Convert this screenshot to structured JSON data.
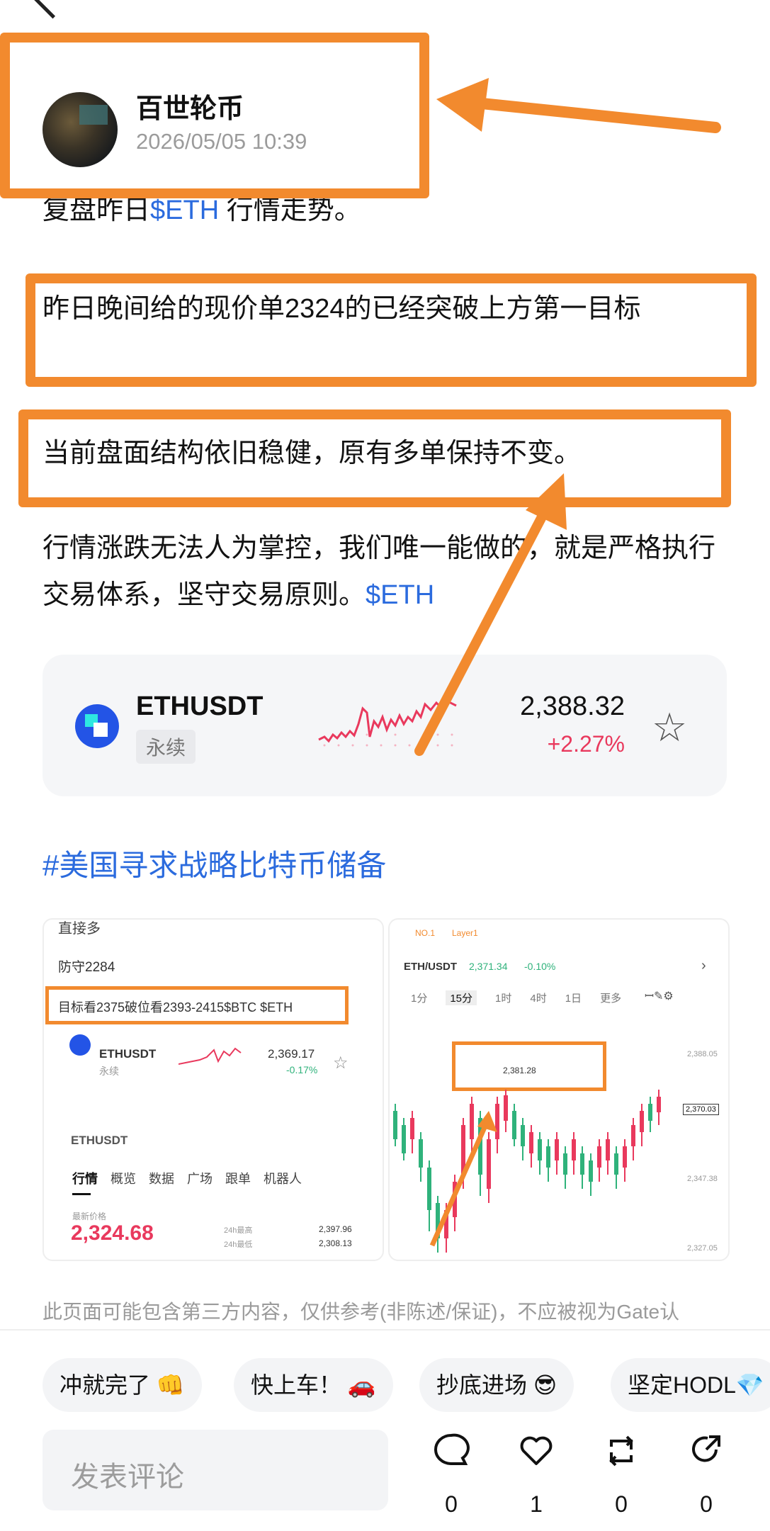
{
  "post": {
    "author": "百世轮币",
    "timestamp": "2026/05/05 10:39",
    "line1_text": "复盘昨日",
    "line1_tag": "$ETH",
    "line1_rest": " 行情走势。",
    "line2": "昨日晚间给的现价单2324的已经突破上方第一目标",
    "line3": "当前盘面结构依旧稳健，原有多单保持不变。",
    "line4_text": "行情涨跌无法人为掌控，我们唯一能做的，就是严格执行交易体系，坚守交易原则。",
    "line4_tag": "$ETH"
  },
  "ticker": {
    "symbol": "ETHUSDT",
    "type_badge": "永续",
    "price": "2,388.32",
    "change": "+2.27%",
    "star_icon": "star-outline-icon"
  },
  "topic": "#美国寻求战略比特币储备",
  "image_left": {
    "line_top": "直接多",
    "line_defense": "防守2284",
    "line_target": "目标看2375破位看2393-2415$BTC $ETH",
    "ticker_symbol": "ETHUSDT",
    "ticker_badge": "永续",
    "ticker_price": "2,369.17",
    "ticker_change": "-0.17%",
    "partial_symbol": "ETHUSDT",
    "tabs": [
      "行情",
      "概览",
      "数据",
      "广场",
      "跟单",
      "机器人"
    ],
    "last_price_label": "最新价格",
    "last_price": "2,324.68",
    "high_label": "24h最高",
    "high_value": "2,397.96",
    "low_label": "24h最低",
    "low_value": "2,308.13"
  },
  "image_right": {
    "header_tag1": "NO.1",
    "header_tag2": "Layer1",
    "pair": "ETH/USDT",
    "pair_price": "2,371.34",
    "pair_change": "-0.10%",
    "intervals": [
      "1分",
      "15分",
      "1时",
      "4时",
      "1日",
      "更多"
    ],
    "high_label": "2,381.28",
    "price_axis": [
      "2,388.05",
      "2,370.03",
      "2,347.38",
      "2,327.05"
    ],
    "current_tag": "2,370.03"
  },
  "disclaimer": "此页面可能包含第三方内容，仅供参考(非陈述/保证)，不应被视为Gate认",
  "quick_replies": [
    "冲就完了 👊",
    "快上车！ 🚗",
    "抄底进场 😎",
    "坚定HODL💎"
  ],
  "comment_placeholder": "发表评论",
  "actions": [
    {
      "icon": "comment-icon",
      "count": "0"
    },
    {
      "icon": "like-icon",
      "count": "1"
    },
    {
      "icon": "repost-icon",
      "count": "0"
    },
    {
      "icon": "share-icon",
      "count": "0"
    }
  ],
  "colors": {
    "accent_blue": "#2b6bde",
    "annotation_orange": "#f28a2e",
    "up_red": "#e9395d",
    "down_green": "#2fb27b"
  }
}
